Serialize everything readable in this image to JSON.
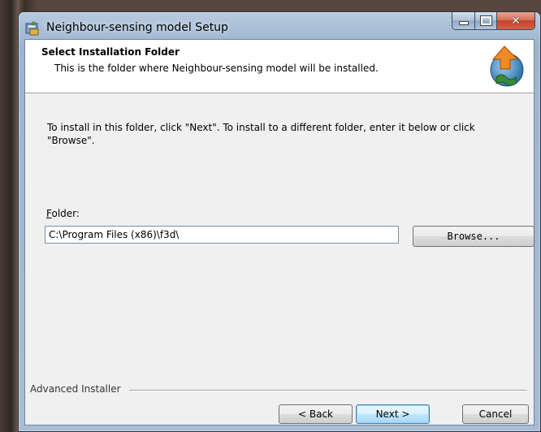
{
  "window": {
    "title": "Neighbour-sensing model Setup",
    "close_glyph": "✕"
  },
  "header": {
    "title": "Select Installation Folder",
    "subtitle": "This is the folder where Neighbour-sensing model will be installed."
  },
  "body": {
    "instructions": "To install in this folder, click \"Next\". To install to a different folder, enter it below or click \"Browse\".",
    "folder_label_accel": "F",
    "folder_label_rest": "older:",
    "folder_value": "C:\\Program Files (x86)\\f3d\\",
    "browse_label": "Browse..."
  },
  "footer": {
    "brand": "Advanced Installer",
    "back_label": "< Back",
    "next_label": "Next >",
    "cancel_label": "Cancel"
  }
}
